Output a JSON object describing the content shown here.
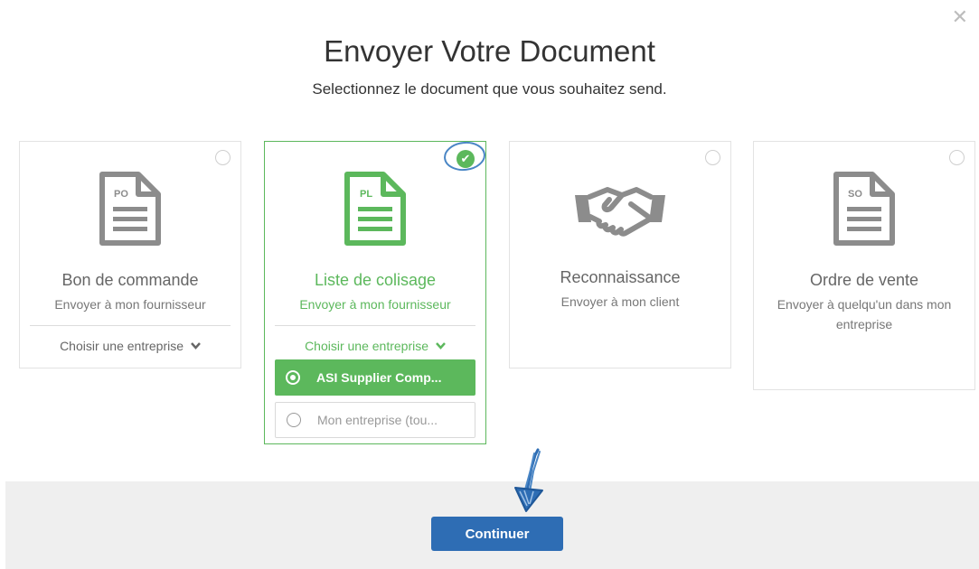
{
  "modal": {
    "title": "Envoyer Votre Document",
    "subtitle": "Selectionnez le document que vous souhaitez send.",
    "close_icon": "close-icon"
  },
  "cards": [
    {
      "code": "PO",
      "title": "Bon de commande",
      "subtitle": "Envoyer à mon fournisseur",
      "choose_label": "Choisir une entreprise",
      "selected": false
    },
    {
      "code": "PL",
      "title": "Liste de colisage",
      "subtitle": "Envoyer à mon fournisseur",
      "choose_label": "Choisir une entreprise",
      "selected": true,
      "options": [
        {
          "label": "ASI Supplier Comp...",
          "selected": true
        },
        {
          "label": "Mon entreprise (tou...",
          "selected": false
        }
      ]
    },
    {
      "code": "",
      "title": "Reconnaissance",
      "subtitle": "Envoyer à mon client",
      "icon": "handshake-icon",
      "selected": false
    },
    {
      "code": "SO",
      "title": "Ordre de vente",
      "subtitle": "Envoyer à quelqu'un dans mon entreprise",
      "selected": false
    }
  ],
  "footer": {
    "continue_label": "Continuer"
  },
  "colors": {
    "green": "#5cb85c",
    "blue": "#2e6db4",
    "grey_icon": "#8c8c8c",
    "annotation": "#4a86c5"
  }
}
